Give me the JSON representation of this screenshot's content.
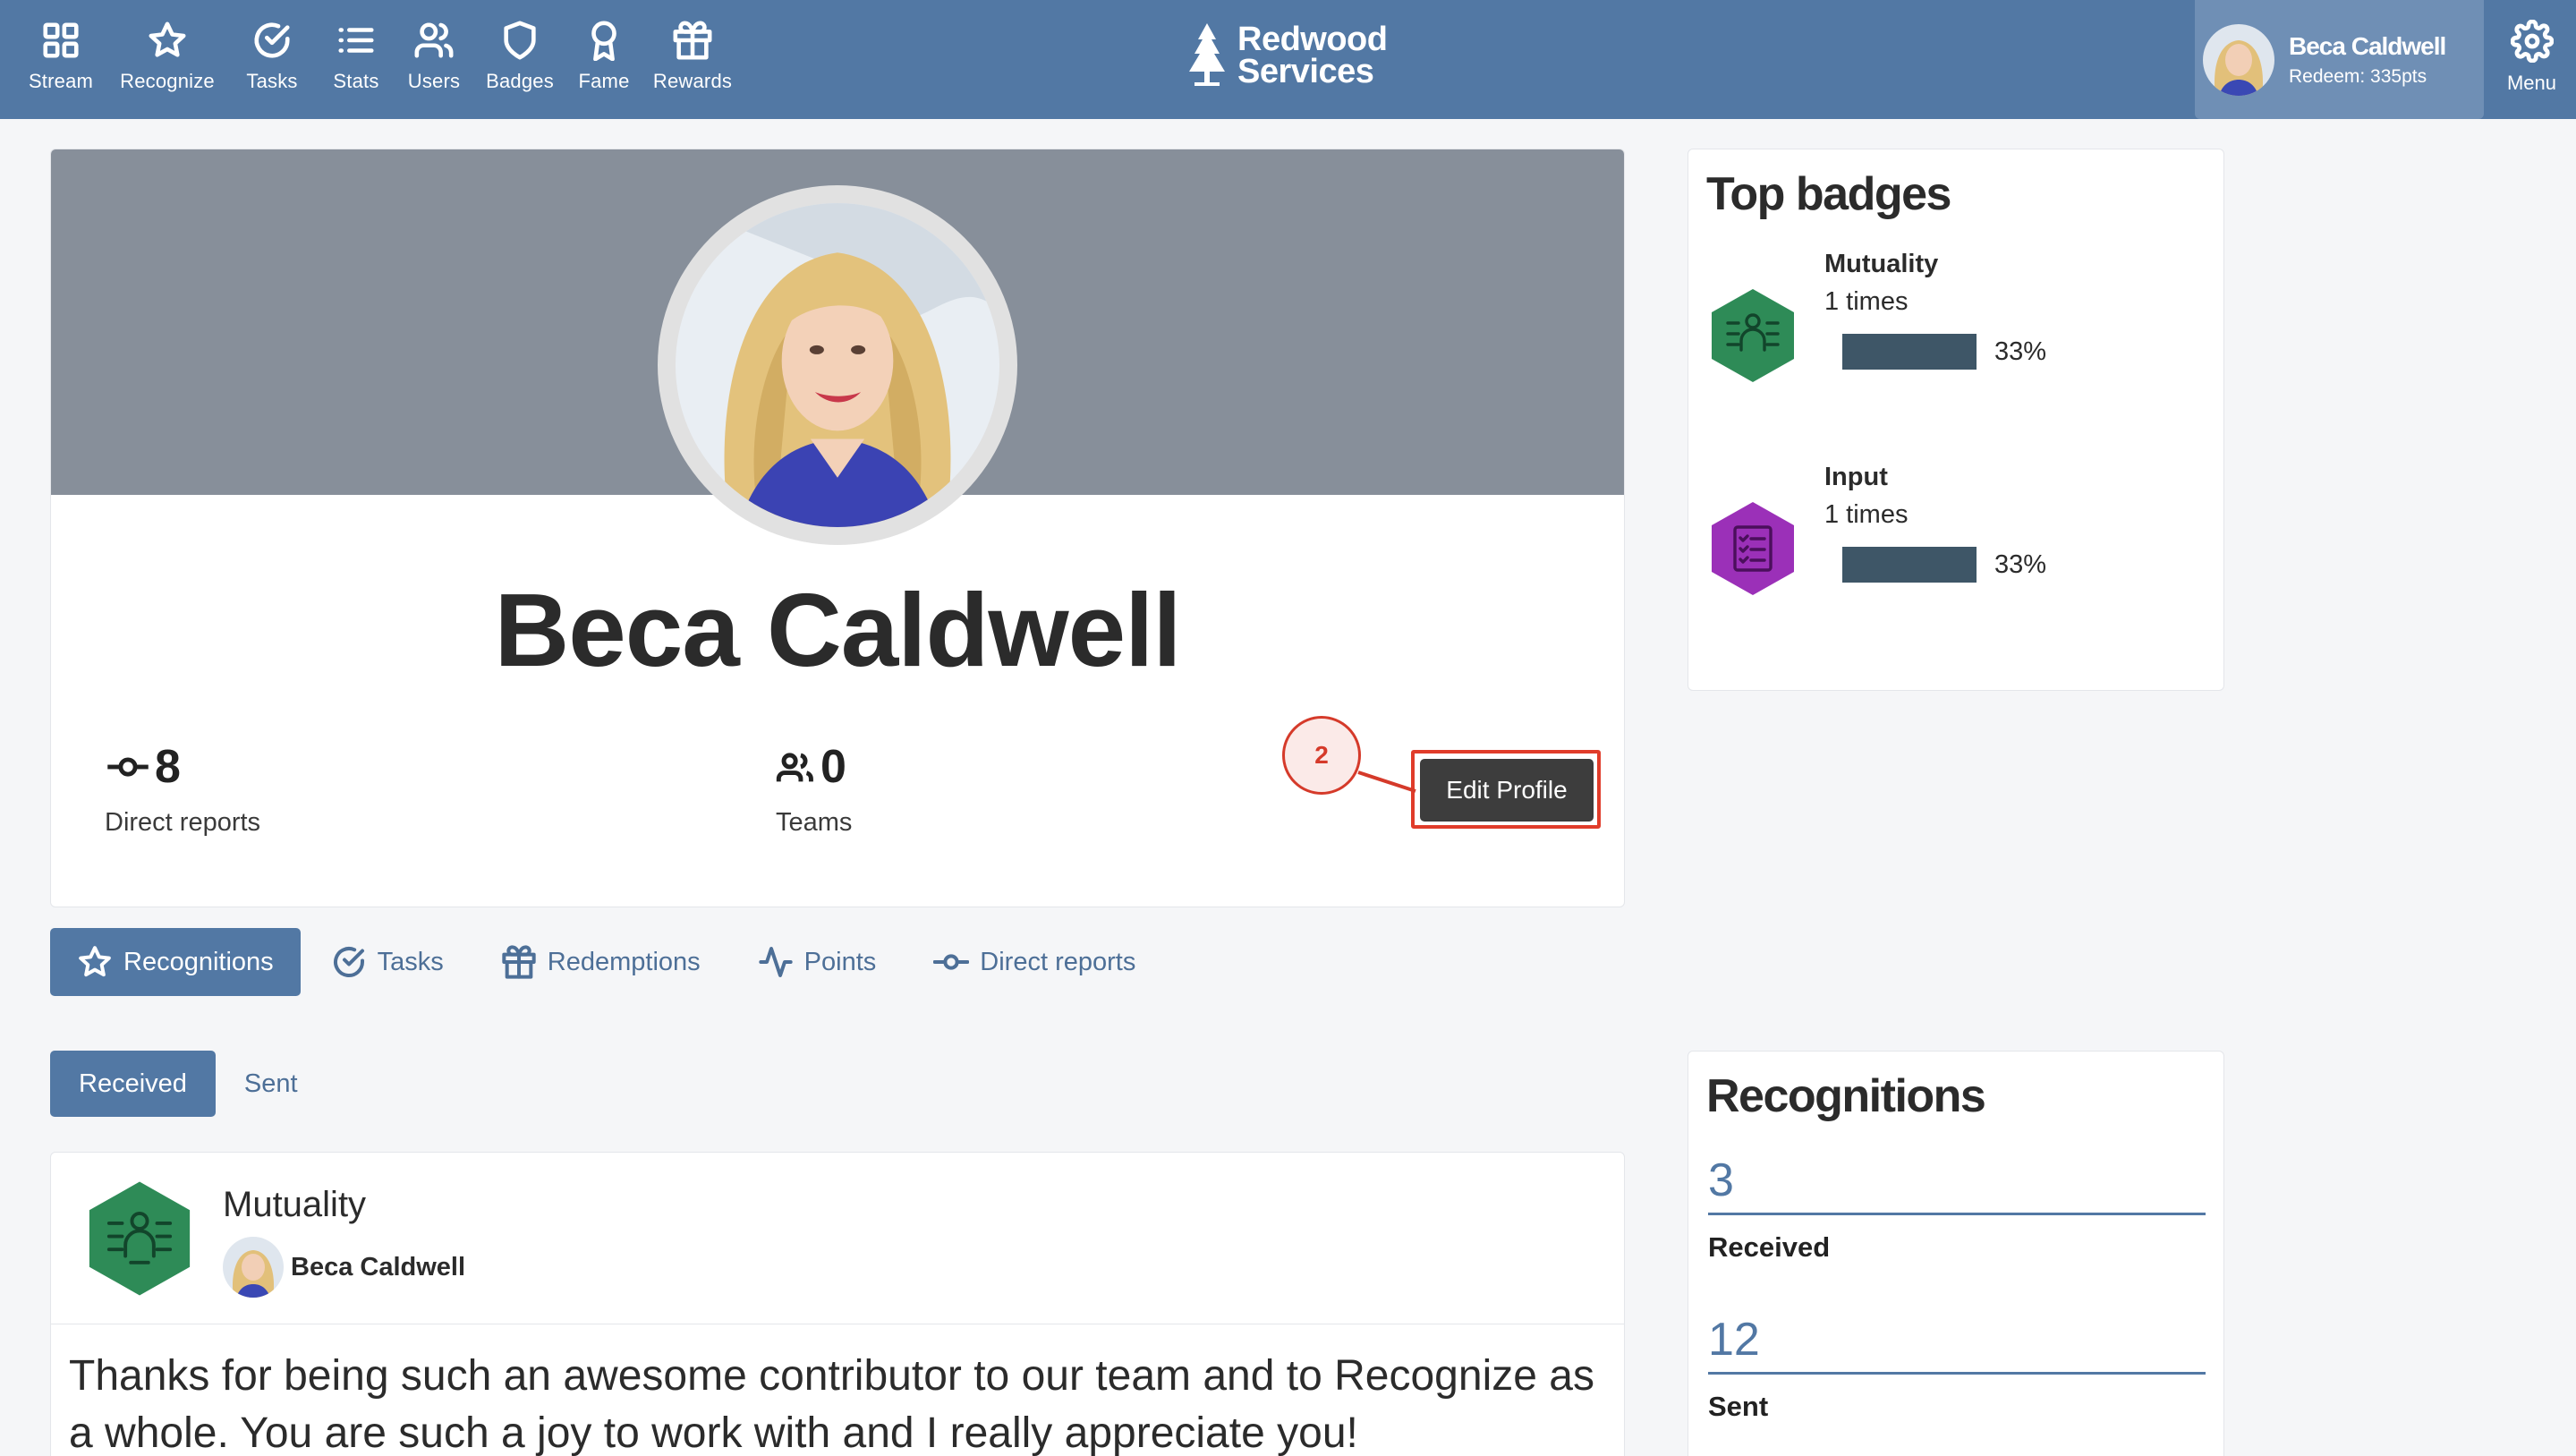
{
  "nav": {
    "items": [
      {
        "label": "Stream",
        "icon": "grid-icon"
      },
      {
        "label": "Recognize",
        "icon": "star-icon"
      },
      {
        "label": "Tasks",
        "icon": "check-circle-icon"
      },
      {
        "label": "Stats",
        "icon": "list-icon"
      },
      {
        "label": "Users",
        "icon": "users-icon"
      },
      {
        "label": "Badges",
        "icon": "shield-icon"
      },
      {
        "label": "Fame",
        "icon": "award-icon"
      },
      {
        "label": "Rewards",
        "icon": "gift-icon"
      }
    ]
  },
  "brand": {
    "line1": "Redwood",
    "line2": "Services"
  },
  "user": {
    "name": "Beca Caldwell",
    "redeem": "Redeem: 335pts"
  },
  "menu": {
    "label": "Menu"
  },
  "profile": {
    "name": "Beca Caldwell",
    "direct_reports": {
      "value": "8",
      "label": "Direct reports"
    },
    "teams": {
      "value": "0",
      "label": "Teams"
    },
    "edit_button": "Edit Profile",
    "step_marker": "2"
  },
  "tabs": [
    {
      "label": "Recognitions",
      "icon": "star-icon",
      "active": true
    },
    {
      "label": "Tasks",
      "icon": "check-circle-icon"
    },
    {
      "label": "Redemptions",
      "icon": "gift-icon"
    },
    {
      "label": "Points",
      "icon": "activity-icon"
    },
    {
      "label": "Direct reports",
      "icon": "commit-icon"
    }
  ],
  "subtabs": [
    {
      "label": "Received",
      "active": true
    },
    {
      "label": "Sent"
    }
  ],
  "recognition": {
    "badge": "Mutuality",
    "from": "Beca Caldwell",
    "message": "Thanks for being such an awesome contributor to our team and to Recognize as a whole. You are such a joy to work with and I really appreciate you!"
  },
  "top_badges": {
    "title": "Top badges",
    "items": [
      {
        "name": "Mutuality",
        "count": "1 times",
        "percent": "33%",
        "fraction": 0.33,
        "color": "#2e8b57"
      },
      {
        "name": "Input",
        "count": "1 times",
        "percent": "33%",
        "fraction": 0.33,
        "color": "#9b30b8"
      }
    ]
  },
  "recognitions_summary": {
    "title": "Recognitions",
    "received": {
      "value": "3",
      "label": "Received"
    },
    "sent": {
      "value": "12",
      "label": "Sent"
    }
  },
  "colors": {
    "topbar": "#5278a4",
    "accent": "#5278a4",
    "highlight": "#e03c2a"
  }
}
